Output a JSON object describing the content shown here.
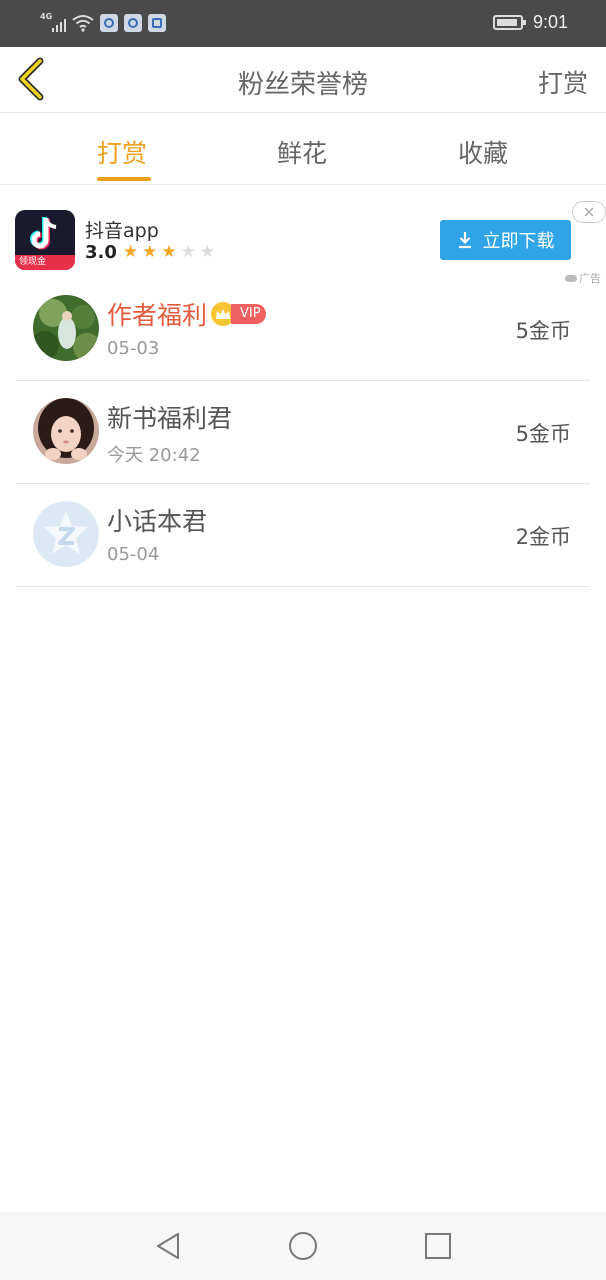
{
  "status_bar": {
    "network": "4G",
    "time": "9:01"
  },
  "header": {
    "title": "粉丝荣誉榜",
    "action_label": "打赏"
  },
  "tabs": [
    {
      "label": "打赏",
      "active": true
    },
    {
      "label": "鲜花",
      "active": false
    },
    {
      "label": "收藏",
      "active": false
    }
  ],
  "ad": {
    "app_name": "抖音app",
    "icon_badge": "领现金",
    "rating": "3.0",
    "stars_filled": 3,
    "stars_total": 5,
    "button_label": "立即下载",
    "ad_label": "广告"
  },
  "list": [
    {
      "name": "作者福利",
      "vip": true,
      "vip_label": "VIP",
      "date": "05-03",
      "amount": "5金币",
      "highlight": true
    },
    {
      "name": "新书福利君",
      "vip": false,
      "date": "今天 20:42",
      "amount": "5金币",
      "highlight": false
    },
    {
      "name": "小话本君",
      "vip": false,
      "date": "05-04",
      "amount": "2金币",
      "highlight": false
    }
  ],
  "colors": {
    "accent": "#f0a020",
    "highlight_name": "#e55a3c",
    "download_button": "#2fa4e7",
    "status_bar": "#4a4a4a"
  }
}
